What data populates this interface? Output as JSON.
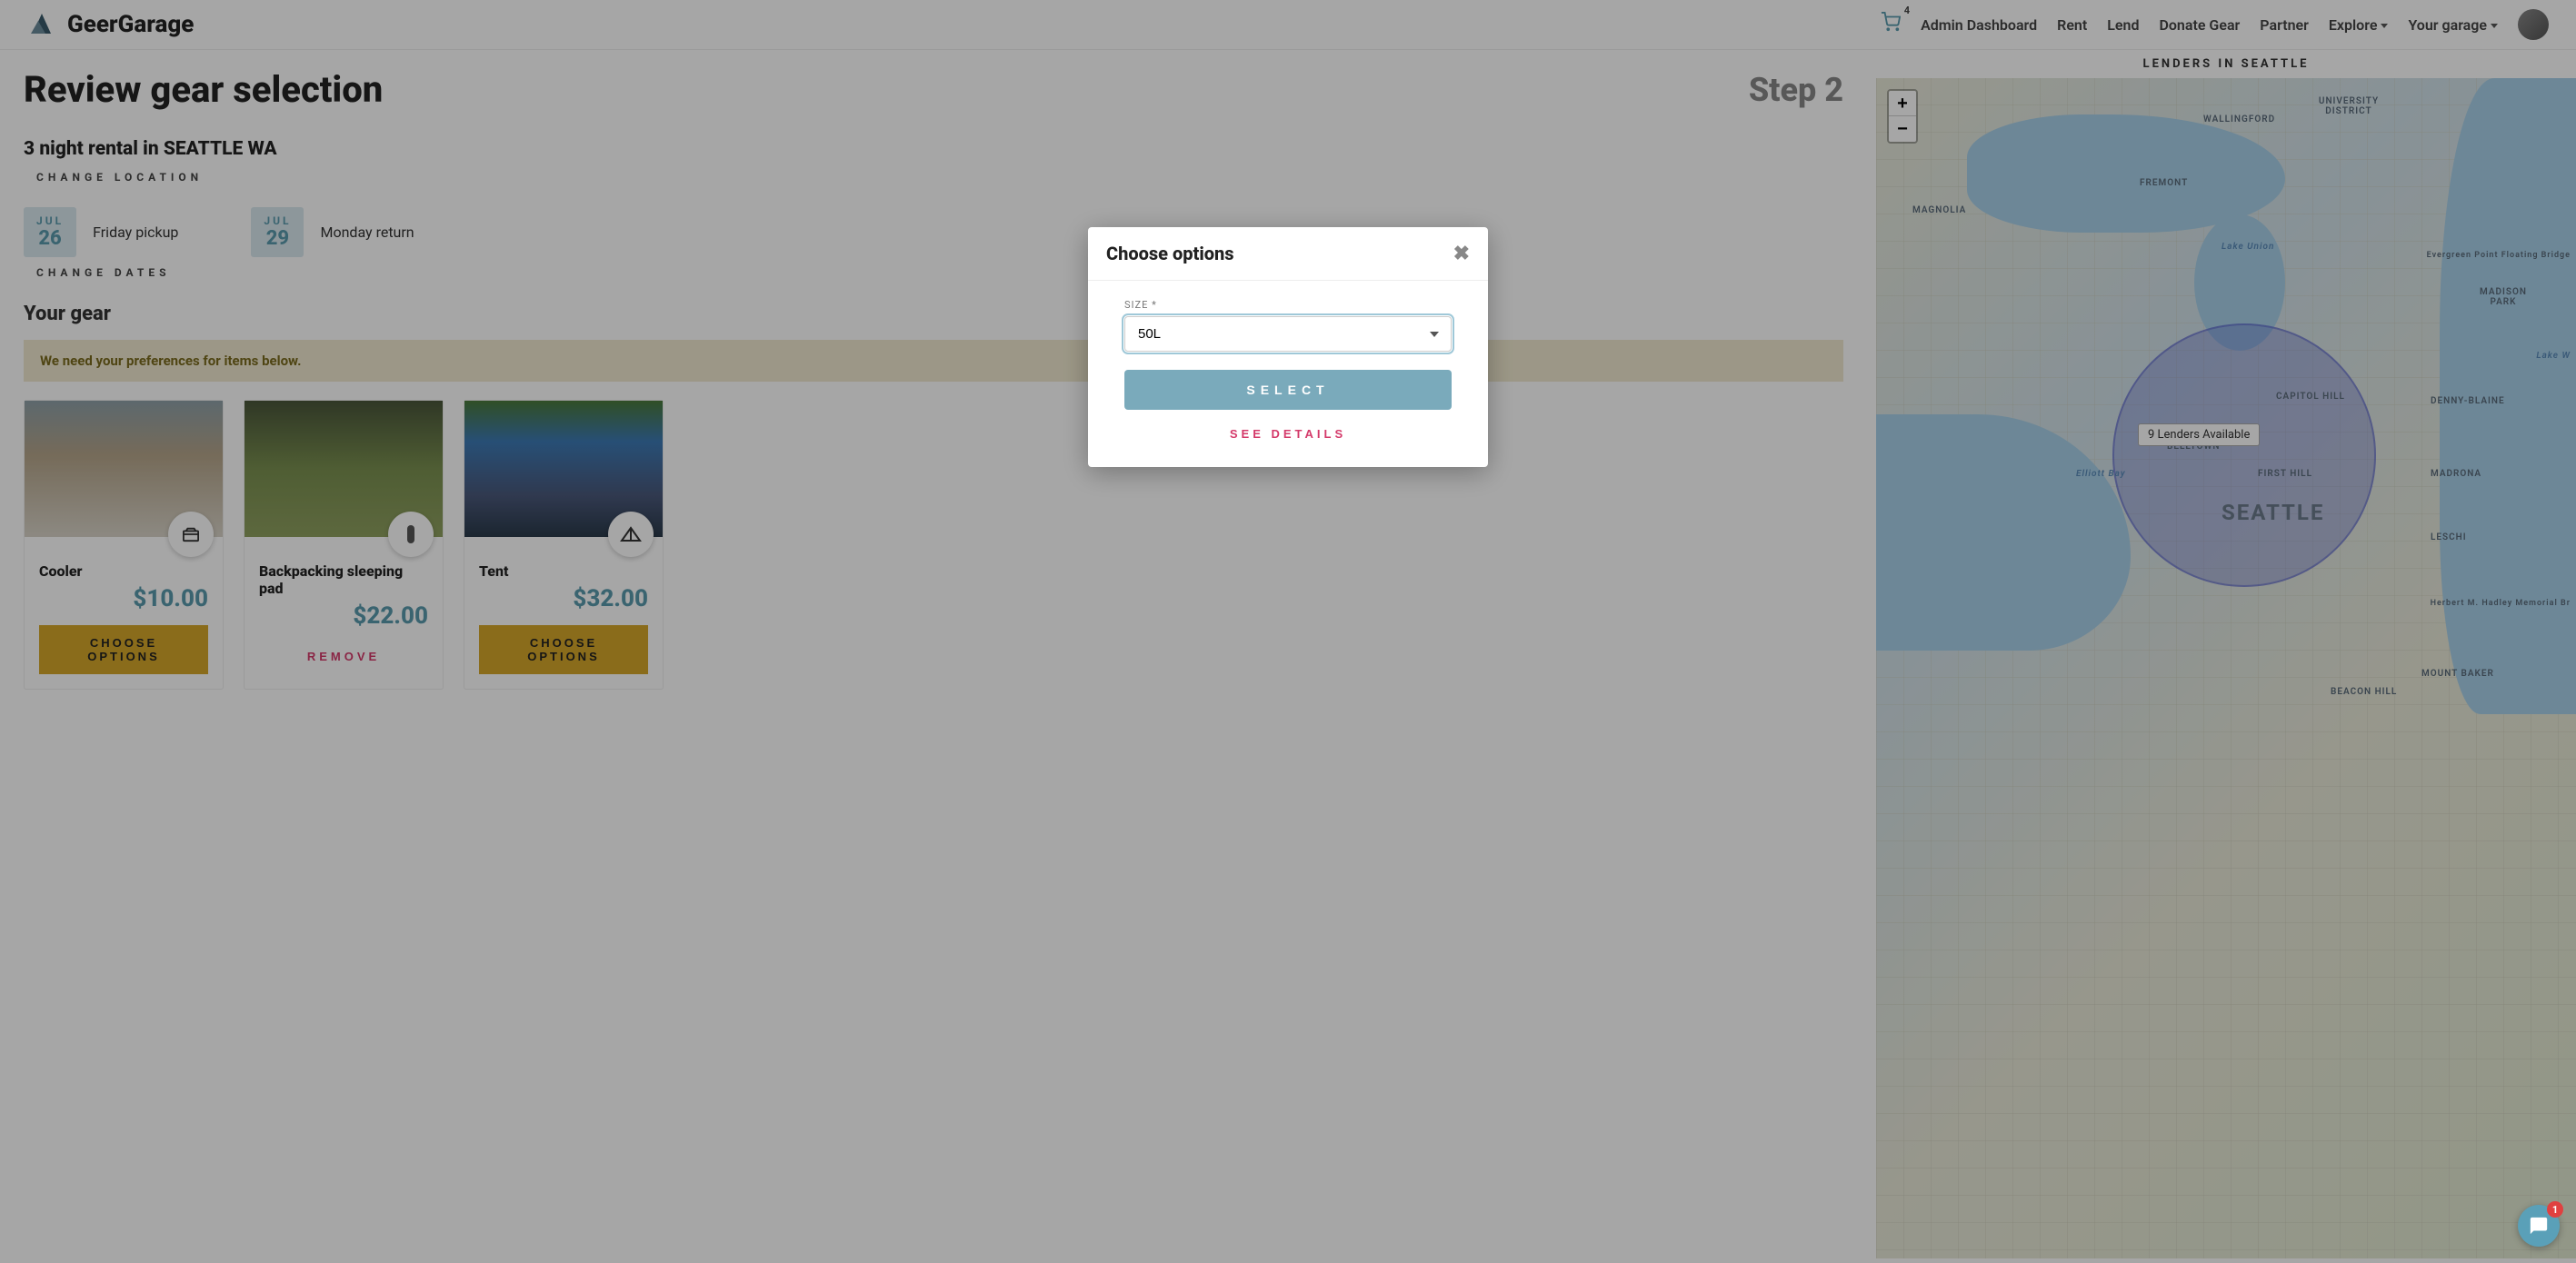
{
  "brand": "GeerGarage",
  "cart_count": "4",
  "nav": {
    "admin": "Admin Dashboard",
    "rent": "Rent",
    "lend": "Lend",
    "donate": "Donate Gear",
    "partner": "Partner",
    "explore": "Explore",
    "garage": "Your garage"
  },
  "page": {
    "title": "Review gear selection",
    "step": "Step 2",
    "subtitle": "3 night rental in SEATTLE WA",
    "change_location": "CHANGE LOCATION",
    "change_dates": "CHANGE DATES",
    "your_gear": "Your gear",
    "warning": "We need your preferences for items below."
  },
  "dates": {
    "pickup": {
      "month": "JUL",
      "day": "26",
      "label": "Friday pickup"
    },
    "return": {
      "month": "JUL",
      "day": "29",
      "label": "Monday return"
    }
  },
  "gear": [
    {
      "name": "Cooler",
      "price": "$10.00",
      "action": "CHOOSE OPTIONS",
      "action_type": "choose"
    },
    {
      "name": "Backpacking sleeping pad",
      "price": "$22.00",
      "action": "REMOVE",
      "action_type": "remove"
    },
    {
      "name": "Tent",
      "price": "$32.00",
      "action": "CHOOSE OPTIONS",
      "action_type": "choose"
    }
  ],
  "map": {
    "title": "LENDERS IN SEATTLE",
    "zoom_in": "+",
    "zoom_out": "−",
    "tooltip": "9 Lenders Available",
    "city": "SEATTLE",
    "labels": {
      "wallingford": "WALLINGFORD",
      "university": "UNIVERSITY DISTRICT",
      "fremont": "FREMONT",
      "magnolia": "MAGNOLIA",
      "lake_union": "Lake Union",
      "madison_park": "MADISON PARK",
      "capitol_hill": "CAPITOL HILL",
      "denny_blaine": "DENNY-BLAINE",
      "belltown": "BELLTOWN",
      "first_hill": "FIRST HILL",
      "madrona": "MADRONA",
      "leschi": "LESCHI",
      "elliott_bay": "Elliott Bay",
      "beacon_hill": "BEACON HILL",
      "mount_baker": "MOUNT BAKER",
      "lake_wa": "Lake W",
      "bridge": "Evergreen Point Floating Bridge",
      "hadley": "Herbert M. Hadley Memorial Br"
    }
  },
  "modal": {
    "title": "Choose options",
    "size_label": "SIZE *",
    "size_value": "50L",
    "select_btn": "SELECT",
    "details_btn": "SEE DETAILS"
  },
  "chat_badge": "1"
}
